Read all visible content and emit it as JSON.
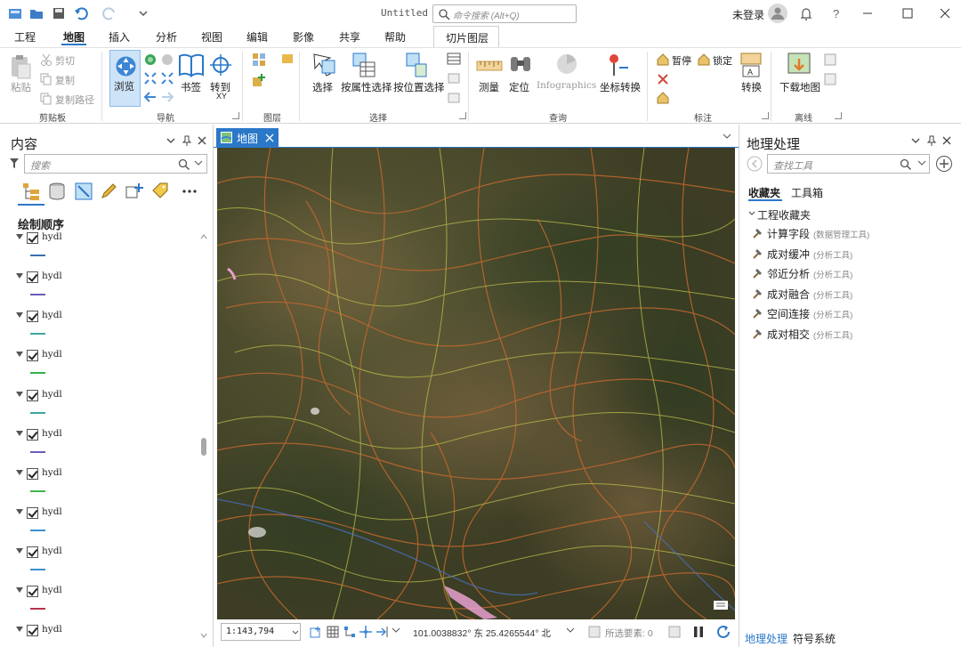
{
  "window": {
    "title": "Untitled",
    "command_search_placeholder": "命令搜索 (Alt+Q)",
    "user_status": "未登录"
  },
  "ribbon_tabs": [
    "工程",
    "地图",
    "插入",
    "分析",
    "视图",
    "编辑",
    "影像",
    "共享",
    "帮助"
  ],
  "active_tab": "地图",
  "contextual_tab": "切片图层",
  "ribbon": {
    "clipboard": {
      "label": "剪贴板",
      "paste": "粘贴",
      "cut": "剪切",
      "copy": "复制",
      "copy_path": "复制路径"
    },
    "navigate": {
      "label": "导航",
      "explore": "浏览",
      "bookmarks": "书签",
      "goto_xy": "转到",
      "goto_xy_sub": "XY"
    },
    "layer": {
      "label": "图层"
    },
    "selection": {
      "label": "选择",
      "select": "选择",
      "select_by_attr": "按属性选择",
      "select_by_loc": "按位置选择"
    },
    "inquiry": {
      "label": "查询",
      "measure": "测量",
      "locate": "定位",
      "infographics": "Infographics",
      "convert_coords": "坐标转换"
    },
    "labeling": {
      "label": "标注",
      "pause": "暂停",
      "lock": "锁定",
      "convert": "转换"
    },
    "offline": {
      "label": "离线",
      "download_map": "下载地图"
    }
  },
  "contents_pane": {
    "title": "内容",
    "search_placeholder": "搜索",
    "drawing_order": "绘制顺序",
    "layers": [
      {
        "name": "hydl",
        "color": "#3a6fb0"
      },
      {
        "name": "hydl",
        "color": "#6b5bb8"
      },
      {
        "name": "hydl",
        "color": "#3aa6a0"
      },
      {
        "name": "hydl",
        "color": "#2fb34a"
      },
      {
        "name": "hydl",
        "color": "#3aa6a0"
      },
      {
        "name": "hydl",
        "color": "#6b5bb8"
      },
      {
        "name": "hydl",
        "color": "#3fb54a"
      },
      {
        "name": "hydl",
        "color": "#3a8fd0"
      },
      {
        "name": "hydl",
        "color": "#3a8fd0"
      },
      {
        "name": "hydl",
        "color": "#b8334a"
      },
      {
        "name": "hydl",
        "color": "#3a6fb0"
      }
    ]
  },
  "map_view": {
    "tab_label": "地图",
    "scale": "1:143,794",
    "coordinates": "101.0038832° 东  25.4265544° 北",
    "selected_features": "所选要素: 0"
  },
  "geoprocessing_pane": {
    "title": "地理处理",
    "search_placeholder": "查找工具",
    "tabs": [
      "收藏夹",
      "工具箱"
    ],
    "section": "工程收藏夹",
    "favorites": [
      {
        "name": "计算字段",
        "toolbox": "(数据管理工具)"
      },
      {
        "name": "成对缓冲",
        "toolbox": "(分析工具)"
      },
      {
        "name": "邻近分析",
        "toolbox": "(分析工具)"
      },
      {
        "name": "成对融合",
        "toolbox": "(分析工具)"
      },
      {
        "name": "空间连接",
        "toolbox": "(分析工具)"
      },
      {
        "name": "成对相交",
        "toolbox": "(分析工具)"
      }
    ],
    "bottom_tabs": [
      "地理处理",
      "符号系统"
    ]
  },
  "colors": {
    "accent": "#2b78c9",
    "map_background": "#4a4a2e"
  }
}
